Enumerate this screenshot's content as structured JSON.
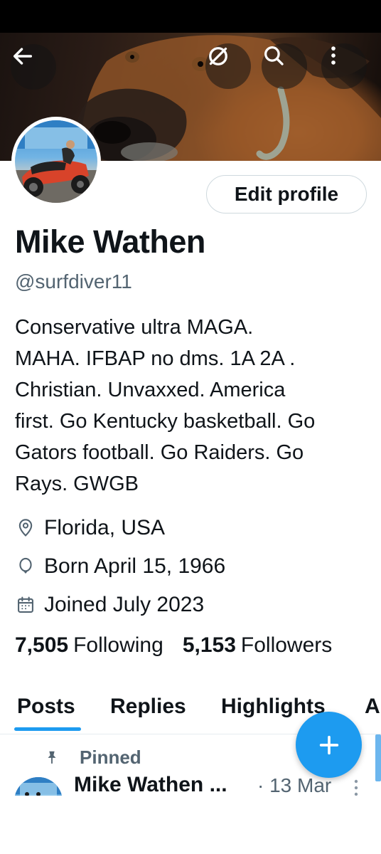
{
  "header": {
    "back_icon": "arrow-left-icon",
    "grok_icon": "grok-icon",
    "search_icon": "search-icon",
    "more_icon": "more-vertical-icon"
  },
  "profile": {
    "edit_button_label": "Edit profile",
    "name": "Mike Wathen",
    "handle": "@surfdiver11",
    "bio": "Conservative ultra MAGA.\nMAHA. IFBAP no dms. 1A 2A .\nChristian. Unvaxxed. America\nfirst. Go Kentucky basketball. Go\nGators football. Go Raiders. Go\nRays. GWGB",
    "location": "Florida, USA",
    "birthday": "Born April 15, 1966",
    "joined": "Joined July 2023",
    "following_count": "7,505",
    "following_label": "Following",
    "followers_count": "5,153",
    "followers_label": "Followers"
  },
  "tabs": [
    {
      "label": "Posts",
      "active": true
    },
    {
      "label": "Replies",
      "active": false
    },
    {
      "label": "Highlights",
      "active": false
    },
    {
      "label": "A",
      "active": false
    }
  ],
  "pinned_post": {
    "pinned_label": "Pinned",
    "author": "Mike Wathen ...",
    "date": "· 13 Mar"
  },
  "colors": {
    "accent": "#1d9bf0",
    "text_primary": "#0f1419",
    "text_secondary": "#536471",
    "border": "#cfd9de"
  }
}
